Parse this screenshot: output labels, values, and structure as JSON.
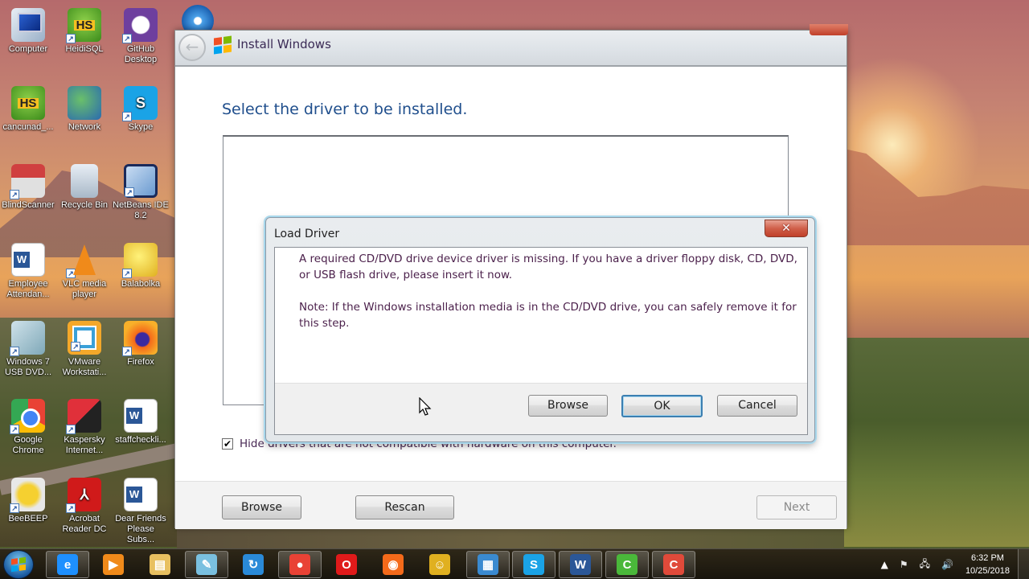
{
  "desktop": {
    "icons": [
      {
        "label": "Computer",
        "kind": "computer-icon",
        "shortcut": false
      },
      {
        "label": "HeidiSQL",
        "kind": "heidisql-icon",
        "shortcut": true
      },
      {
        "label": "GitHub Desktop",
        "kind": "github-icon",
        "shortcut": true
      },
      {
        "label": "cancunad_...",
        "kind": "heidisql-icon",
        "shortcut": false
      },
      {
        "label": "Network",
        "kind": "network-icon",
        "shortcut": false
      },
      {
        "label": "Skype",
        "kind": "skype-icon",
        "shortcut": true
      },
      {
        "label": "BlindScanner",
        "kind": "scanner-icon",
        "shortcut": true
      },
      {
        "label": "Recycle Bin",
        "kind": "recycle-bin-icon",
        "shortcut": false
      },
      {
        "label": "NetBeans IDE 8.2",
        "kind": "netbeans-icon",
        "shortcut": true
      },
      {
        "label": "Employee Attendan...",
        "kind": "word-document-icon",
        "shortcut": false
      },
      {
        "label": "VLC media player",
        "kind": "vlc-icon",
        "shortcut": true
      },
      {
        "label": "Balabolka",
        "kind": "balabolka-icon",
        "shortcut": true
      },
      {
        "label": "Windows 7 USB DVD...",
        "kind": "windows-usb-tool-icon",
        "shortcut": true
      },
      {
        "label": "VMware Workstati...",
        "kind": "vmware-icon",
        "shortcut": true
      },
      {
        "label": "Firefox",
        "kind": "firefox-icon",
        "shortcut": true
      },
      {
        "label": "Google Chrome",
        "kind": "chrome-icon",
        "shortcut": true
      },
      {
        "label": "Kaspersky Internet...",
        "kind": "kaspersky-icon",
        "shortcut": true
      },
      {
        "label": "staffcheckli...",
        "kind": "word-document-icon",
        "shortcut": false
      },
      {
        "label": "BeeBEEP",
        "kind": "beebeep-icon",
        "shortcut": true
      },
      {
        "label": "Acrobat Reader DC",
        "kind": "acrobat-icon",
        "shortcut": true
      },
      {
        "label": "Dear Friends Please Subs...",
        "kind": "word-document-icon",
        "shortcut": false
      }
    ]
  },
  "install_window": {
    "title": "Install Windows",
    "heading": "Select the driver to be installed.",
    "hide_incompatible_checkbox": {
      "label": "Hide drivers that are not compatible with hardware on this computer.",
      "checked": true,
      "check_glyph": "✔"
    },
    "buttons": {
      "browse": "Browse",
      "rescan": "Rescan",
      "next": "Next"
    },
    "back_glyph": "←"
  },
  "load_driver_dialog": {
    "title": "Load Driver",
    "close_glyph": "✕",
    "message_1": "A required CD/DVD drive device driver is missing. If you have a driver floppy disk, CD, DVD, or USB flash drive, please insert it now.",
    "message_2": "Note: If the Windows installation media is in the CD/DVD drive, you can safely remove it for this step.",
    "buttons": {
      "browse": "Browse",
      "ok": "OK",
      "cancel": "Cancel"
    }
  },
  "taskbar": {
    "items": [
      {
        "name": "internet-explorer",
        "glyph": "e",
        "color": "#1e90ff",
        "open": true
      },
      {
        "name": "media-player",
        "glyph": "▶",
        "color": "#f08a1a",
        "open": false
      },
      {
        "name": "file-explorer",
        "glyph": "▤",
        "color": "#e8c060",
        "open": false
      },
      {
        "name": "notepad",
        "glyph": "✎",
        "color": "#7ac0e0",
        "open": true
      },
      {
        "name": "app-blue",
        "glyph": "↻",
        "color": "#2a8ad8",
        "open": false
      },
      {
        "name": "chrome",
        "glyph": "●",
        "color": "#e94235",
        "open": true
      },
      {
        "name": "opera",
        "glyph": "O",
        "color": "#e01a1a",
        "open": false
      },
      {
        "name": "firefox",
        "glyph": "◉",
        "color": "#f46a1a",
        "open": false
      },
      {
        "name": "balabolka",
        "glyph": "☺",
        "color": "#e0b020",
        "open": false
      },
      {
        "name": "control-panel",
        "glyph": "▦",
        "color": "#3a8ad0",
        "open": true
      },
      {
        "name": "skype",
        "glyph": "S",
        "color": "#1aa3e6",
        "open": true
      },
      {
        "name": "word",
        "glyph": "W",
        "color": "#2b5797",
        "open": true
      },
      {
        "name": "camtasia",
        "glyph": "C",
        "color": "#4ab83a",
        "open": true
      },
      {
        "name": "camtasia-recorder",
        "glyph": "C",
        "color": "#e04a3a",
        "open": true
      }
    ],
    "tray": {
      "show_hidden_glyph": "▲",
      "action_center_glyph": "⚑",
      "network_glyph": "🖧",
      "volume_glyph": "🔊",
      "time": "6:32 PM",
      "date": "10/25/2018"
    }
  }
}
